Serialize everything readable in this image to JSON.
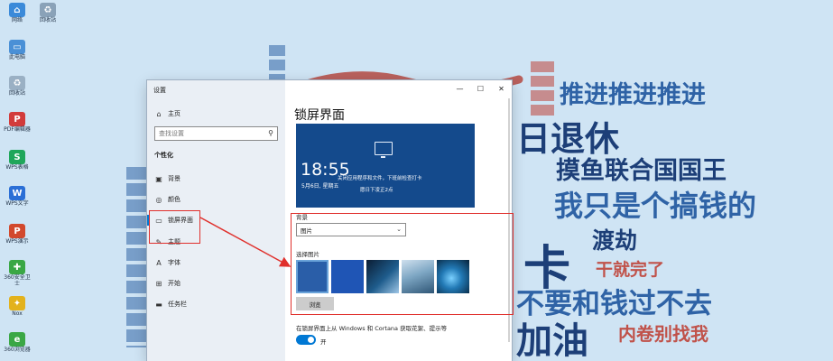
{
  "desktop": {
    "icons": [
      {
        "label": "网络",
        "icon": "network-icon",
        "color": "#3b8ad9"
      },
      {
        "label": "回收站",
        "icon": "recycle-bin-icon",
        "color": "#8aa2b8"
      },
      {
        "label": "此电脑",
        "icon": "computer-icon",
        "color": "#4a90d6"
      },
      {
        "label": "回收站",
        "icon": "recycle-bin-icon",
        "color": "#9ab0c4"
      },
      {
        "label": "PDF编辑器",
        "icon": "pdf-icon",
        "color": "#d23b3b"
      },
      {
        "label": "WPS表格",
        "icon": "wps-sheet-icon",
        "color": "#1fa65a"
      },
      {
        "label": "WPS文字",
        "icon": "wps-doc-icon",
        "color": "#2b6fd6"
      },
      {
        "label": "WPS演示",
        "icon": "wps-ppt-icon",
        "color": "#d2482c"
      },
      {
        "label": "360安全卫士",
        "icon": "shield-icon",
        "color": "#3aa745"
      },
      {
        "label": "Nox",
        "icon": "emulator-icon",
        "color": "#e3b21d"
      },
      {
        "label": "360浏览器",
        "icon": "browser-icon",
        "color": "#3aa745"
      }
    ]
  },
  "wallpaper": {
    "lines": [
      "推进推进推进",
      "日退休",
      "摸鱼联合国国王",
      "我只是个搞钱的",
      "渡劫",
      "卡",
      "干就完了",
      "不要和钱过不去",
      "加油",
      "内卷别找我"
    ]
  },
  "settings": {
    "window_title": "设置",
    "title_controls": {
      "minimize": "—",
      "maximize": "☐",
      "close": "✕"
    },
    "nav": {
      "home": "主页",
      "search_placeholder": "查找设置",
      "section": "个性化",
      "items": [
        {
          "label": "背景",
          "icon": "image-icon"
        },
        {
          "label": "颜色",
          "icon": "palette-icon"
        },
        {
          "label": "锁屏界面",
          "icon": "lock-screen-icon",
          "active": true
        },
        {
          "label": "主题",
          "icon": "theme-icon"
        },
        {
          "label": "字体",
          "icon": "font-icon"
        },
        {
          "label": "开始",
          "icon": "start-icon"
        },
        {
          "label": "任务栏",
          "icon": "taskbar-icon"
        }
      ]
    },
    "content": {
      "page_title": "锁屏界面",
      "preview": {
        "time": "18:55",
        "date": "5月6日, 星期五",
        "notice_line1": "关闭应用程序和文件，下班前检查打卡",
        "notice_line2": "愿日下凌正2点"
      },
      "background_label": "背景",
      "background_value": "图片",
      "choose_label": "选择图片",
      "browse_button": "浏览",
      "cortana_label": "在锁屏界面上从 Windows 和 Cortana 获取花絮、提示等",
      "toggle_state": "开"
    }
  },
  "colors": {
    "accent": "#0078d4",
    "annotation": "#e0302c",
    "wallpaper_bg": "#cfe4f4"
  }
}
